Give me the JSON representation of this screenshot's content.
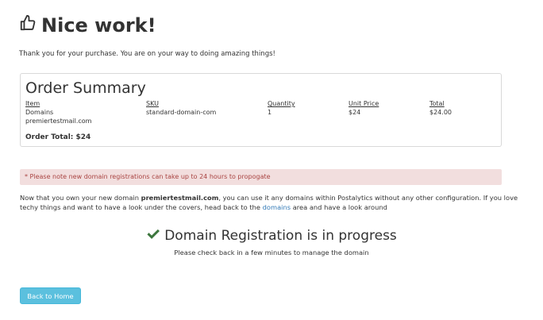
{
  "header": {
    "icon": "thumbs-up-icon",
    "title": "Nice work!"
  },
  "thanks_text": "Thank you for your purchase. You are on your way to doing amazing things!",
  "order_summary": {
    "title": "Order Summary",
    "columns": [
      "Item",
      "SKU",
      "Quantity",
      "Unit Price",
      "Total"
    ],
    "rows": [
      {
        "item_line1": "Domains",
        "item_line2": "premiertestmail.com",
        "sku": "standard-domain-com",
        "quantity": "1",
        "unit_price": "$24",
        "total": "$24.00"
      }
    ],
    "order_total": "Order Total: $24"
  },
  "notice": {
    "text": "* Please note new domain registrations can take up to 24 hours to propogate",
    "bg_color": "#f2dede",
    "text_color": "#a94442"
  },
  "info": {
    "part1": "Now that you own your new domain ",
    "domain": "premiertestmail.com",
    "part2": ", you can use it any domains within Postalytics without any other configuration. If you love techy things and want to have a look under the covers, head back to the ",
    "link": "domains",
    "part3": " area and have a look around"
  },
  "progress": {
    "icon": "checkmark-icon",
    "icon_color": "#3c763d",
    "title": "Domain Registration is in progress",
    "subtitle": "Please check back in a few minutes to manage the domain"
  },
  "back_button": {
    "label": "Back to Home",
    "color": "#5bc0de"
  }
}
